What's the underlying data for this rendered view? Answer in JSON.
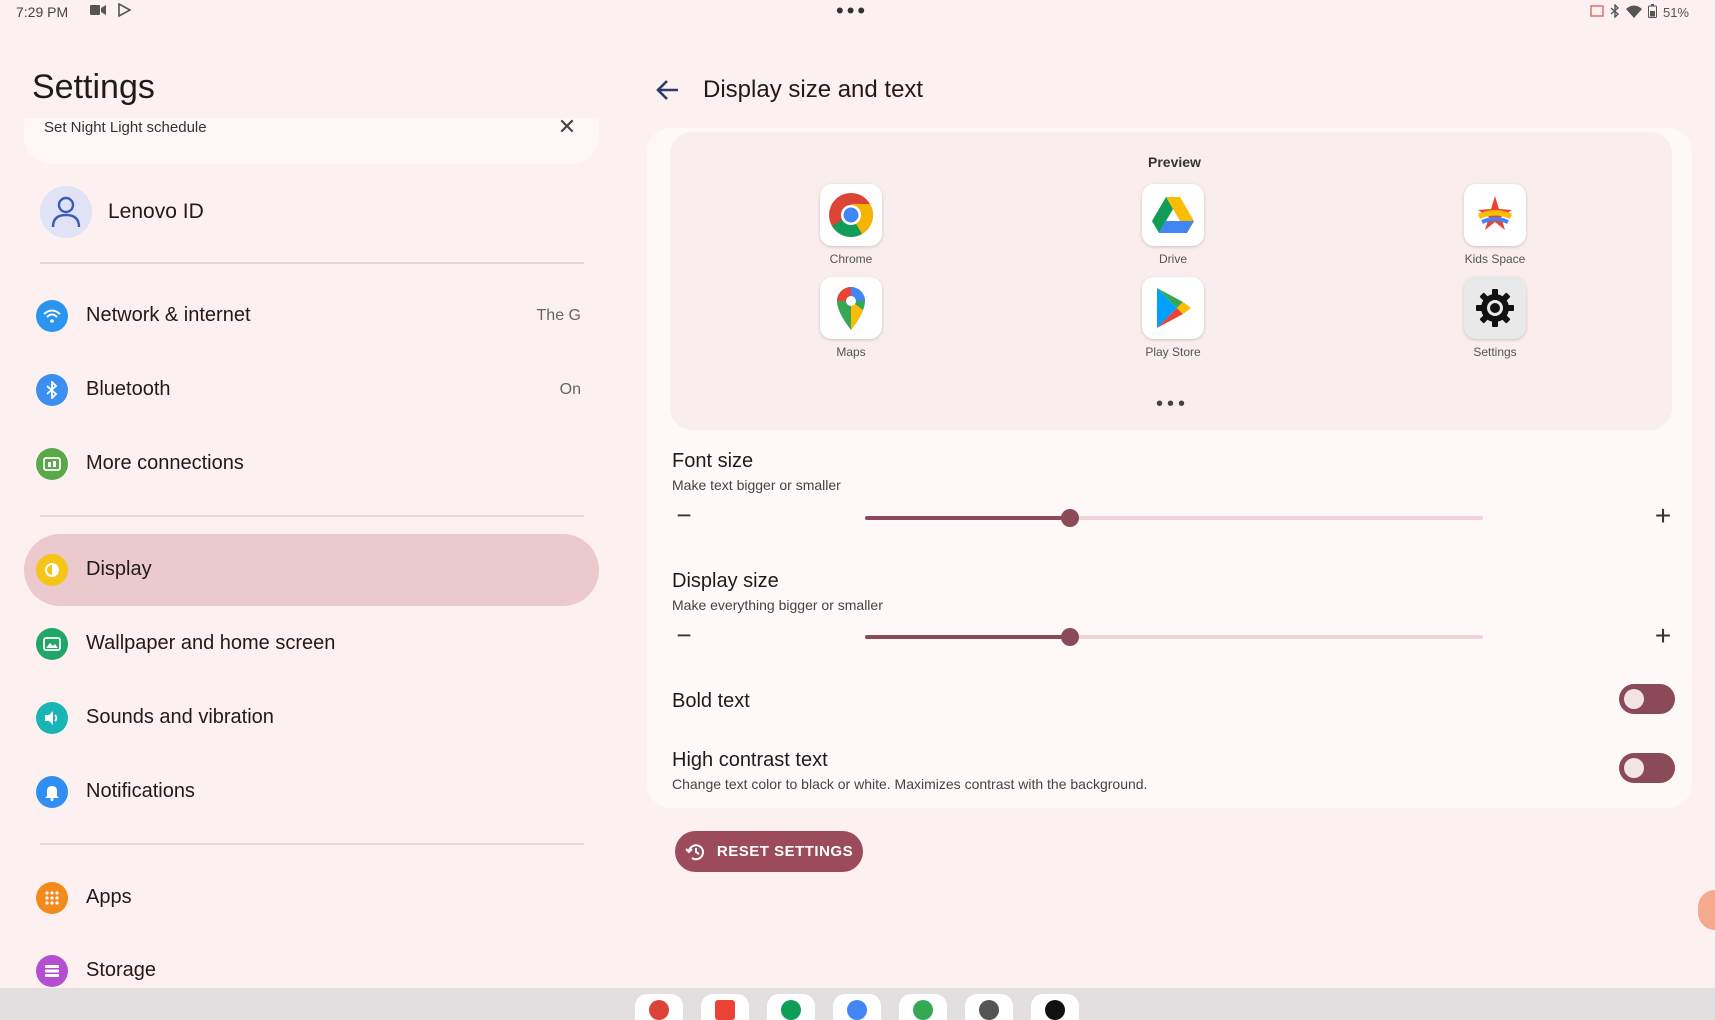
{
  "status_bar": {
    "time": "7:29 PM",
    "battery": "51%",
    "icons": [
      "video-icon",
      "play-store-icon",
      "cast-icon",
      "bluetooth-icon",
      "wifi-icon",
      "battery-icon"
    ]
  },
  "sidebar": {
    "title": "Settings",
    "suggestion": {
      "text": "Set Night Light schedule"
    },
    "account": {
      "label": "Lenovo ID"
    },
    "items": [
      {
        "label": "Network & internet",
        "sub": "The G",
        "icon": "wifi-icon",
        "color": "#2b94f0"
      },
      {
        "label": "Bluetooth",
        "sub": "On",
        "icon": "bluetooth-icon",
        "color": "#3b8ff0"
      },
      {
        "label": "More connections",
        "sub": "",
        "icon": "connections-icon",
        "color": "#5aa84a"
      },
      {
        "label": "Display",
        "sub": "",
        "icon": "display-icon",
        "color": "#f5c518",
        "active": true
      },
      {
        "label": "Wallpaper and home screen",
        "sub": "",
        "icon": "wallpaper-icon",
        "color": "#21a66a"
      },
      {
        "label": "Sounds and vibration",
        "sub": "",
        "icon": "sound-icon",
        "color": "#19b5b5"
      },
      {
        "label": "Notifications",
        "sub": "",
        "icon": "bell-icon",
        "color": "#2f8ff2"
      },
      {
        "label": "Apps",
        "sub": "",
        "icon": "apps-icon",
        "color": "#f28a1c"
      },
      {
        "label": "Storage",
        "sub": "",
        "icon": "storage-icon",
        "color": "#b54fd1"
      }
    ]
  },
  "main": {
    "title": "Display size and text",
    "preview": {
      "label": "Preview",
      "apps": [
        {
          "name": "Chrome",
          "icon": "chrome-icon"
        },
        {
          "name": "Drive",
          "icon": "drive-icon"
        },
        {
          "name": "Kids Space",
          "icon": "kids-space-icon"
        },
        {
          "name": "Maps",
          "icon": "maps-icon"
        },
        {
          "name": "Play Store",
          "icon": "play-store-icon"
        },
        {
          "name": "Settings",
          "icon": "settings-gear-icon"
        }
      ]
    },
    "font_size": {
      "title": "Font size",
      "subtitle": "Make text bigger or smaller",
      "minus": "−",
      "plus": "+",
      "level": 0.33
    },
    "display_size": {
      "title": "Display size",
      "subtitle": "Make everything bigger or smaller",
      "minus": "−",
      "plus": "+",
      "level": 0.33
    },
    "bold_text": {
      "title": "Bold text",
      "enabled": false
    },
    "high_contrast": {
      "title": "High contrast text",
      "subtitle": "Change text color to black or white. Maximizes contrast with the background.",
      "enabled": false
    },
    "reset_button": {
      "label": "RESET SETTINGS"
    }
  },
  "colors": {
    "accent": "#8b4a58",
    "active_nav": "#ecc9cc",
    "background": "#fcf0f0"
  }
}
